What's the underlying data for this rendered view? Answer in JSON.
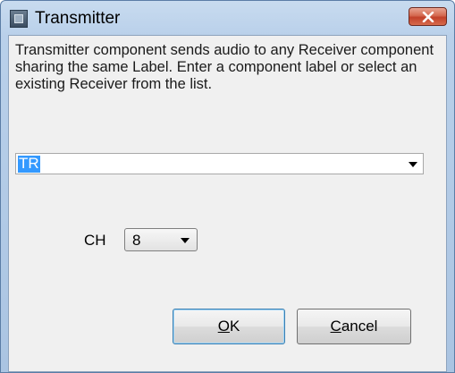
{
  "window": {
    "title": "Transmitter"
  },
  "dialog": {
    "description": "Transmitter component sends audio to any Receiver component sharing the same Label. Enter a component label or select an existing Receiver from the list.",
    "label_field": {
      "value": "TR"
    },
    "channel": {
      "label": "CH",
      "value": "8"
    },
    "buttons": {
      "ok_mnemonic": "O",
      "ok_rest": "K",
      "cancel_mnemonic": "C",
      "cancel_rest": "ancel"
    }
  },
  "icons": {
    "app": "app-icon",
    "close": "close-icon",
    "dropdown": "chevron-down-icon"
  },
  "colors": {
    "selection": "#3399ff",
    "close_button": "#c2412a",
    "title_bar": "#b9d0ea"
  }
}
